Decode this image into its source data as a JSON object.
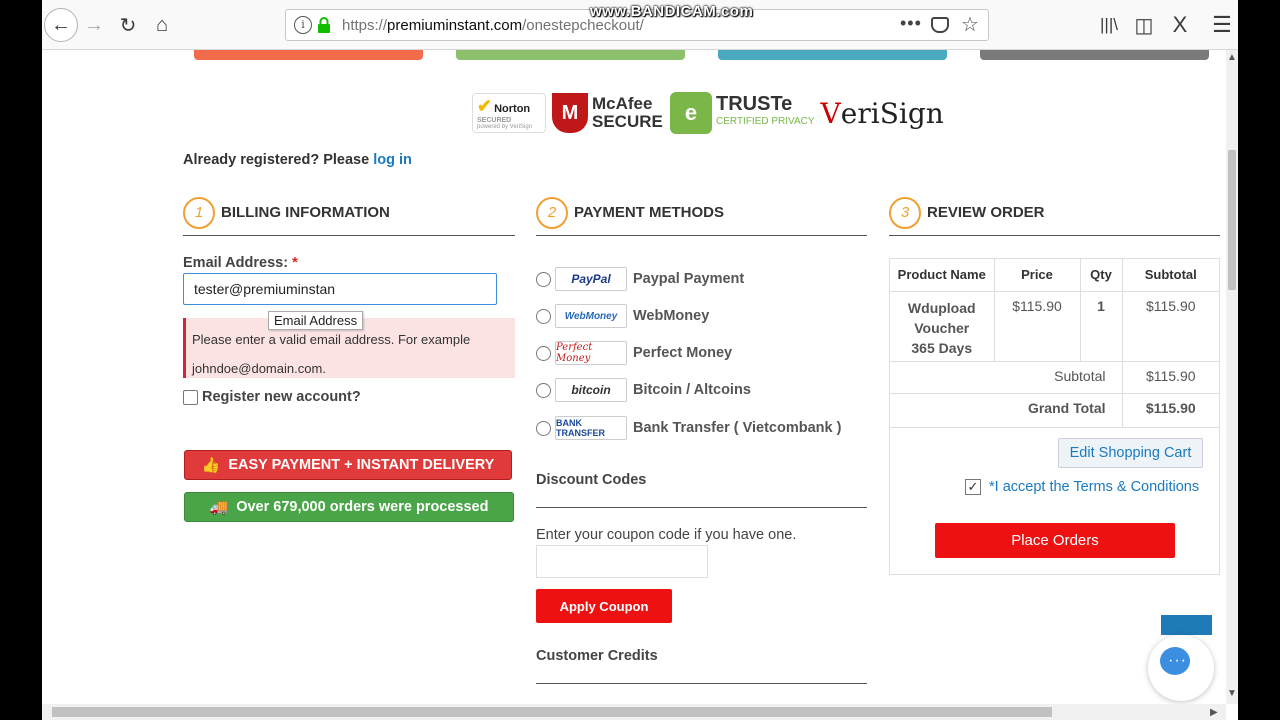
{
  "browser": {
    "url_prefix": "https://",
    "url_host": "premiuminstant.com",
    "url_path": "/onestepcheckout/",
    "watermark": "www.BANDICAM.com"
  },
  "trust_seals": {
    "norton": "Norton",
    "norton_sub": "SECURED",
    "norton_powered": "powered by VeriSign",
    "mcafee": "McAfee",
    "mcafee_sub": "SECURE",
    "truste": "TRUSTe",
    "truste_sub": "CERTIFIED PRIVACY",
    "verisign_v": "V",
    "verisign_rest": "eriSign"
  },
  "login_prompt": {
    "text": "Already registered? Please ",
    "link": "log in"
  },
  "billing": {
    "step": "1",
    "title": "BILLING INFORMATION",
    "email_label": "Email Address:",
    "required_mark": "*",
    "email_value": "tester@premiuminstan",
    "tooltip": "Email Address",
    "error_line1": "Please enter a valid email address. For example",
    "error_line2": "johndoe@domain.com.",
    "register_label": "Register new account?",
    "easy_payment": "EASY PAYMENT + INSTANT DELIVERY",
    "orders_processed": "Over 679,000 orders were processed"
  },
  "payment": {
    "step": "2",
    "title": "PAYMENT METHODS",
    "methods": [
      {
        "logo": "PayPal",
        "label": "Paypal Payment"
      },
      {
        "logo": "WebMoney",
        "label": "WebMoney"
      },
      {
        "logo": "Perfect Money",
        "label": "Perfect Money"
      },
      {
        "logo": "bitcoin",
        "label": "Bitcoin / Altcoins"
      },
      {
        "logo": "BANK TRANSFER",
        "label": "Bank Transfer ( Vietcombank )"
      }
    ],
    "discount_title": "Discount Codes",
    "coupon_label": "Enter your coupon code if you have one.",
    "apply_button": "Apply Coupon",
    "credits_title": "Customer Credits"
  },
  "review": {
    "step": "3",
    "title": "REVIEW ORDER",
    "columns": [
      "Product Name",
      "Price",
      "Qty",
      "Subtotal"
    ],
    "item": {
      "name_line1": "Wdupload",
      "name_line2": "Voucher",
      "name_line3": "365 Days",
      "price": "$115.90",
      "qty": "1",
      "subtotal": "$115.90"
    },
    "subtotal_label": "Subtotal",
    "subtotal_value": "$115.90",
    "grand_total_label": "Grand Total",
    "grand_total_value": "$115.90",
    "edit_cart": "Edit Shopping Cart",
    "terms_mark": "*",
    "terms": " I accept the Terms & Conditions",
    "place_orders": "Place Orders"
  },
  "colors": {
    "accent_orange": "#f0a030",
    "link_blue": "#1a7ac0",
    "red": "#ee1111",
    "green": "#4aa548"
  }
}
